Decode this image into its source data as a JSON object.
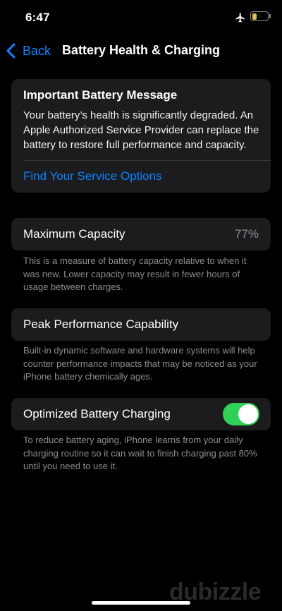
{
  "status_bar": {
    "time": "6:47",
    "battery_level": "6",
    "battery_fraction": 0.06,
    "battery_color": "#d9c25b"
  },
  "nav": {
    "back_label": "Back",
    "title": "Battery Health & Charging",
    "accent": "#0a84ff"
  },
  "message_card": {
    "title": "Important Battery Message",
    "body": "Your battery’s health is significantly degraded. An Apple Authorized Service Provider can replace the battery to restore full performance and capacity.",
    "link": "Find Your Service Options"
  },
  "maximum_capacity": {
    "label": "Maximum Capacity",
    "value": "77%",
    "footnote": "This is a measure of battery capacity relative to when it was new. Lower capacity may result in fewer hours of usage between charges."
  },
  "peak_performance": {
    "label": "Peak Performance Capability",
    "footnote": "Built-in dynamic software and hardware systems will help counter performance impacts that may be noticed as your iPhone battery chemically ages."
  },
  "optimized_charging": {
    "label": "Optimized Battery Charging",
    "enabled": true,
    "toggle_color": "#30d158",
    "footnote": "To reduce battery aging, iPhone learns from your daily charging routine so it can wait to finish charging past 80% until you need to use it."
  },
  "watermark": "dubizzle"
}
